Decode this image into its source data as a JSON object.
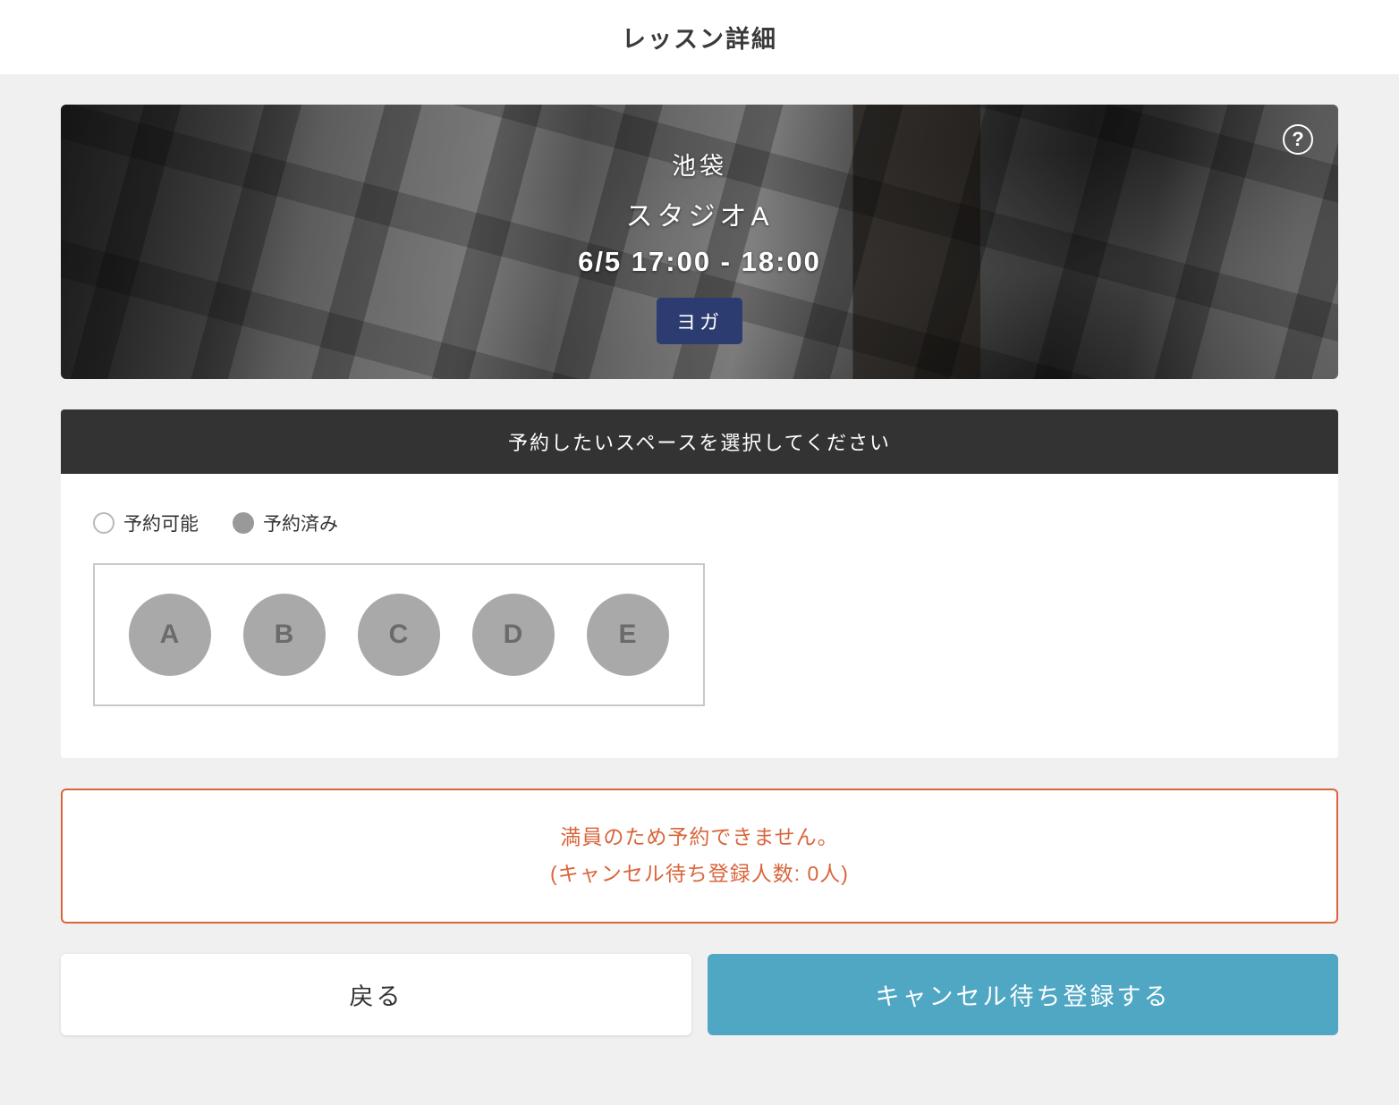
{
  "header": {
    "title": "レッスン詳細"
  },
  "hero": {
    "location": "池袋",
    "studio": "スタジオA",
    "datetime": "6/5  17:00 - 18:00",
    "tag": "ヨガ"
  },
  "instruction": "予約したいスペースを選択してください",
  "legend": {
    "available": "予約可能",
    "reserved": "予約済み"
  },
  "spaces": [
    "A",
    "B",
    "C",
    "D",
    "E"
  ],
  "warning": {
    "line1": "満員のため予約できません。",
    "line2": "(キャンセル待ち登録人数: 0人)"
  },
  "buttons": {
    "back": "戻る",
    "waitlist": "キャンセル待ち登録する"
  }
}
